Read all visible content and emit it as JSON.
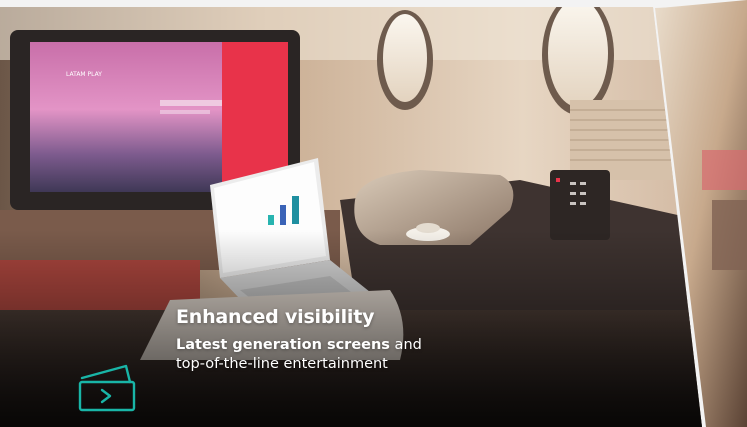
{
  "slide": {
    "title": "Enhanced visibility",
    "body_bold": "Latest generation screens",
    "body_rest_1": " and",
    "body_rest_2": "top-of-the-line entertainment"
  },
  "screen": {
    "brand": "LATAM PLAY"
  },
  "icons": {
    "feature_icon": "tv-play-icon"
  },
  "colors": {
    "accent": "#19b5a7",
    "screen_red": "#e8334a"
  }
}
